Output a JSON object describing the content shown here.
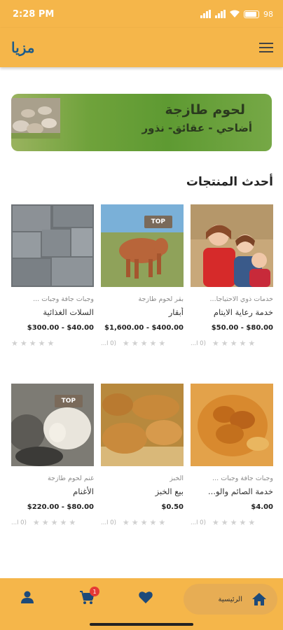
{
  "status_bar": {
    "time": "2:28 PM",
    "battery": "98"
  },
  "app": {
    "logo_text": "مزيا"
  },
  "banner": {
    "title": "لحوم طازجة",
    "subtitle": "أضاحي - عقائق- نذور"
  },
  "section": {
    "title": "أحدث المنتجات"
  },
  "products": [
    {
      "category": "خدمات ذوي الاحتياجا...",
      "name": "خدمة رعاية الايتام",
      "price": "$50.00 - $80.00",
      "rating_count": "(0 ا...",
      "badge": ""
    },
    {
      "category": "بقر لحوم طازجة",
      "name": "أبقار",
      "price": "$1,600.00 - $400.00",
      "rating_count": "(0 ا...",
      "badge": "TOP"
    },
    {
      "category": "وجبات جافة وجبات ...",
      "name": "السلات الغذائية",
      "price": "$300.00 - $40.00",
      "rating_count": "",
      "badge": ""
    },
    {
      "category": "وجبات جافة وجبات ...",
      "name": "خدمة الصائم والو...",
      "price": "$4.00",
      "rating_count": "(0 ا...",
      "badge": ""
    },
    {
      "category": "الخبز",
      "name": "بيع الخبز",
      "price": "$0.50",
      "rating_count": "(0 ا...",
      "badge": ""
    },
    {
      "category": "غنم لحوم طازجة",
      "name": "الأغنام",
      "price": "$220.00 - $80.00",
      "rating_count": "(0 ا...",
      "badge": "TOP"
    }
  ],
  "bottom_nav": {
    "home_label": "الرئيسية",
    "cart_count": "1"
  },
  "colors": {
    "primary": "#f5b64a",
    "home_pill": "#e7ad54",
    "nav_icon": "#1d4a7a",
    "badge": "#e53935"
  }
}
